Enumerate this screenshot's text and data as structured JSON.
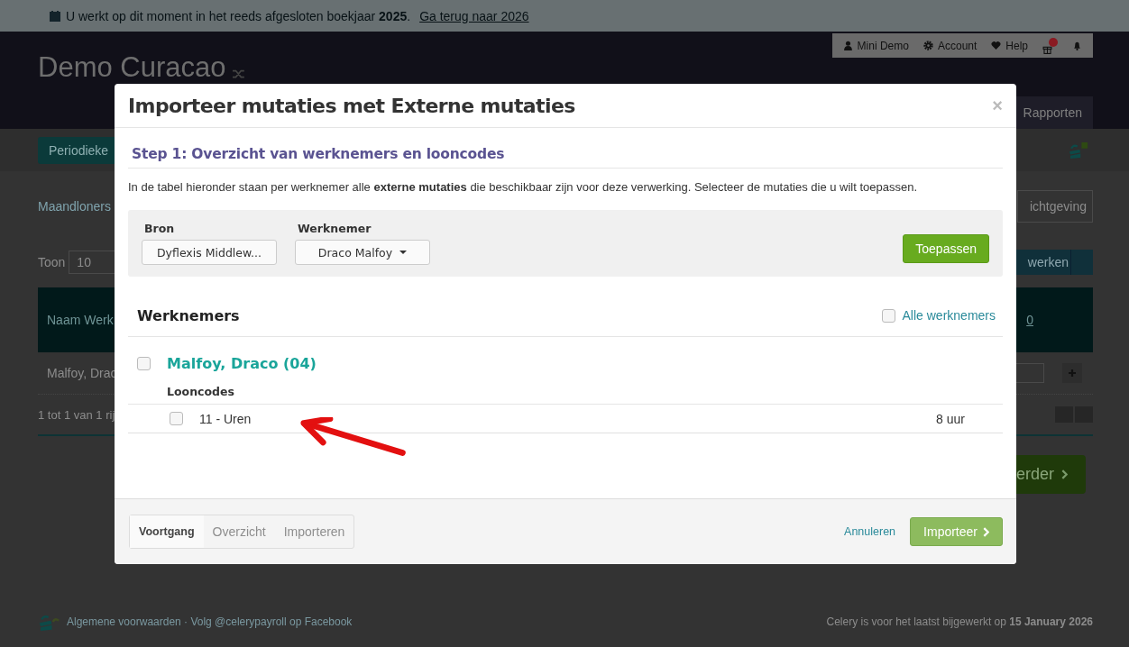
{
  "banner": {
    "text": "U werkt op dit moment in het reeds afgesloten boekjaar **2025**.",
    "link": "Ga terug naar 2026"
  },
  "header": {
    "title": "Demo Curacao",
    "menu": [
      {
        "kind": "user",
        "label": "Mini Demo"
      },
      {
        "kind": "gear",
        "label": "Account"
      },
      {
        "kind": "heart",
        "label": "Help"
      },
      {
        "kind": "gift",
        "badge": true
      },
      {
        "kind": "bell"
      }
    ],
    "tab": "Rapporten"
  },
  "subnav": {
    "button": "Periodieke"
  },
  "page": {
    "group": "Maandloners",
    "filter_field": "ichtgeving",
    "show_label": "Toon",
    "page_size": "10",
    "action_button": "werken",
    "table": {
      "column_1": "Naam Werk",
      "column_last": "0",
      "row": {
        "name": "Malfoy, Drac"
      }
    },
    "info": "1 tot 1 van 1 rij",
    "next_button": "erder"
  },
  "footer": {
    "links": "Algemene voorwaarden · Volg @celerypayroll op Facebook",
    "updated": "Celery is voor het laatst bijgewerkt op **15 January 2026**"
  },
  "modal": {
    "title": "Importeer mutaties met Externe mutaties",
    "close": "×",
    "step_title": "Step 1: Overzicht van werknemers en looncodes",
    "description": "In de tabel hieronder staan per werknemer alle **externe mutaties** die beschikbaar zijn voor deze verwerking. Selecteer de mutaties die u wilt toepassen.",
    "filters": [
      {
        "label": "Bron",
        "value": "Dyflexis Middlew...",
        "dropdown": false
      },
      {
        "label": "Werknemer",
        "value": "Draco Malfoy",
        "dropdown": true
      }
    ],
    "apply": "Toepassen",
    "section_title": "Werknemers",
    "all": {
      "label": "Alle werknemers",
      "checked": false
    },
    "employees": [
      {
        "name": "Malfoy, Draco (04)",
        "checked": false,
        "codes_label": "Looncodes",
        "codes": [
          {
            "label": "11 - Uren",
            "amount": "8 uur",
            "checked": false
          }
        ]
      }
    ],
    "steps": [
      {
        "label": "Voortgang",
        "selected": true
      },
      {
        "label": "Overzicht",
        "selected": false
      },
      {
        "label": "Importeren",
        "selected": false
      }
    ],
    "cancel": "Annuleren",
    "submit": "Importeer"
  }
}
